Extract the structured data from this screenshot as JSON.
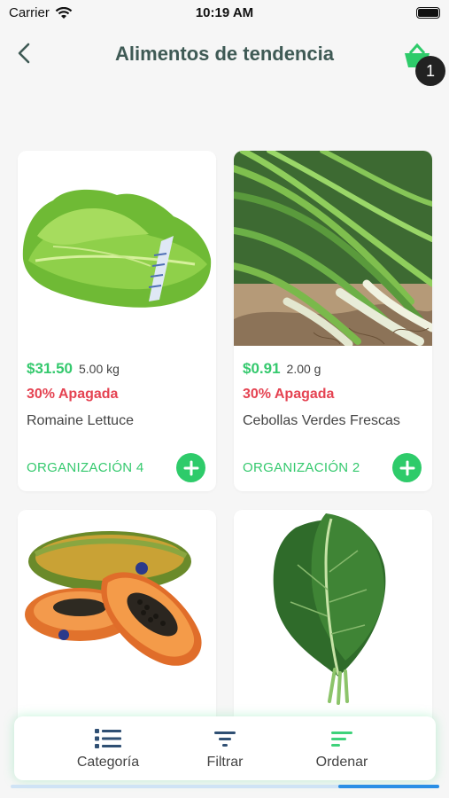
{
  "status_bar": {
    "carrier": "Carrier",
    "time": "10:19 AM"
  },
  "header": {
    "title": "Alimentos de tendencia",
    "cart_count": "1"
  },
  "products": [
    {
      "price": "$31.50",
      "weight": "5.00 kg",
      "discount": "30% Apagada",
      "name": "Romaine Lettuce",
      "org": "ORGANIZACIÓN 4",
      "image": "lettuce-image"
    },
    {
      "price": "$0.91",
      "weight": "2.00 g",
      "discount": "30% Apagada",
      "name": "Cebollas Verdes Frescas",
      "org": "ORGANIZACIÓN 2",
      "image": "green-onions-image"
    },
    {
      "image": "papaya-image"
    },
    {
      "image": "collard-greens-image"
    }
  ],
  "tabs": [
    {
      "label": "Categoría",
      "icon": "list-icon"
    },
    {
      "label": "Filtrar",
      "icon": "filter-icon"
    },
    {
      "label": "Ordenar",
      "icon": "sort-icon"
    }
  ],
  "colors": {
    "accent": "#35c96e",
    "discount": "#e54352",
    "title": "#3f5a55"
  }
}
